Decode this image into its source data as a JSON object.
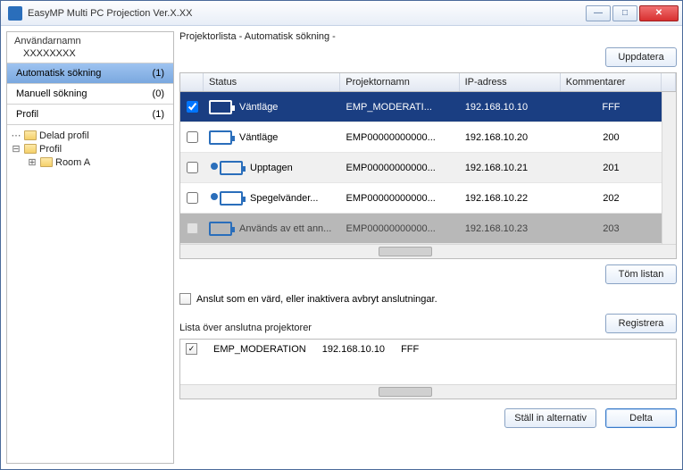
{
  "app": {
    "title": "EasyMP Multi PC Projection Ver.X.XX"
  },
  "sidebar": {
    "username_label": "Användarnamn",
    "username": "XXXXXXXX",
    "nav": [
      {
        "label": "Automatisk sökning",
        "count": "(1)",
        "active": true
      },
      {
        "label": "Manuell sökning",
        "count": "(0)",
        "active": false
      },
      {
        "label": "Profil",
        "count": "(1)",
        "active": false
      }
    ],
    "tree": {
      "shared_profile": "Delad profil",
      "profile": "Profil",
      "room_a": "Room A"
    }
  },
  "main": {
    "list_label": "Projektorlista - Automatisk sökning -",
    "update_btn": "Uppdatera",
    "columns": {
      "status": "Status",
      "name": "Projektornamn",
      "ip": "IP-adress",
      "comment": "Kommentarer"
    },
    "rows": [
      {
        "checked": true,
        "selected": true,
        "status": "Väntläge",
        "name": "EMP_MODERATI...",
        "ip": "192.168.10.10",
        "comment": "FFF",
        "icon": "proj"
      },
      {
        "checked": false,
        "selected": false,
        "status": "Väntläge",
        "name": "EMP00000000000...",
        "ip": "192.168.10.20",
        "comment": "200",
        "icon": "proj"
      },
      {
        "checked": false,
        "selected": false,
        "status": "Upptagen",
        "name": "EMP00000000000...",
        "ip": "192.168.10.21",
        "comment": "201",
        "icon": "proj-person"
      },
      {
        "checked": false,
        "selected": false,
        "status": "Spegelvänder...",
        "name": "EMP00000000000...",
        "ip": "192.168.10.22",
        "comment": "202",
        "icon": "proj-person"
      },
      {
        "checked": false,
        "selected": false,
        "disabled": true,
        "status": "Används av ett ann...",
        "name": "EMP00000000000...",
        "ip": "192.168.10.23",
        "comment": "203",
        "icon": "proj"
      }
    ],
    "clear_list_btn": "Töm listan",
    "host_checkbox_label": "Anslut som en värd, eller inaktivera avbryt anslutningar.",
    "connected_label": "Lista över anslutna projektorer",
    "register_btn": "Registrera",
    "connected_rows": [
      {
        "checked": true,
        "name": "EMP_MODERATION",
        "ip": "192.168.10.10",
        "comment": "FFF"
      }
    ],
    "options_btn": "Ställ in alternativ",
    "join_btn": "Delta"
  }
}
